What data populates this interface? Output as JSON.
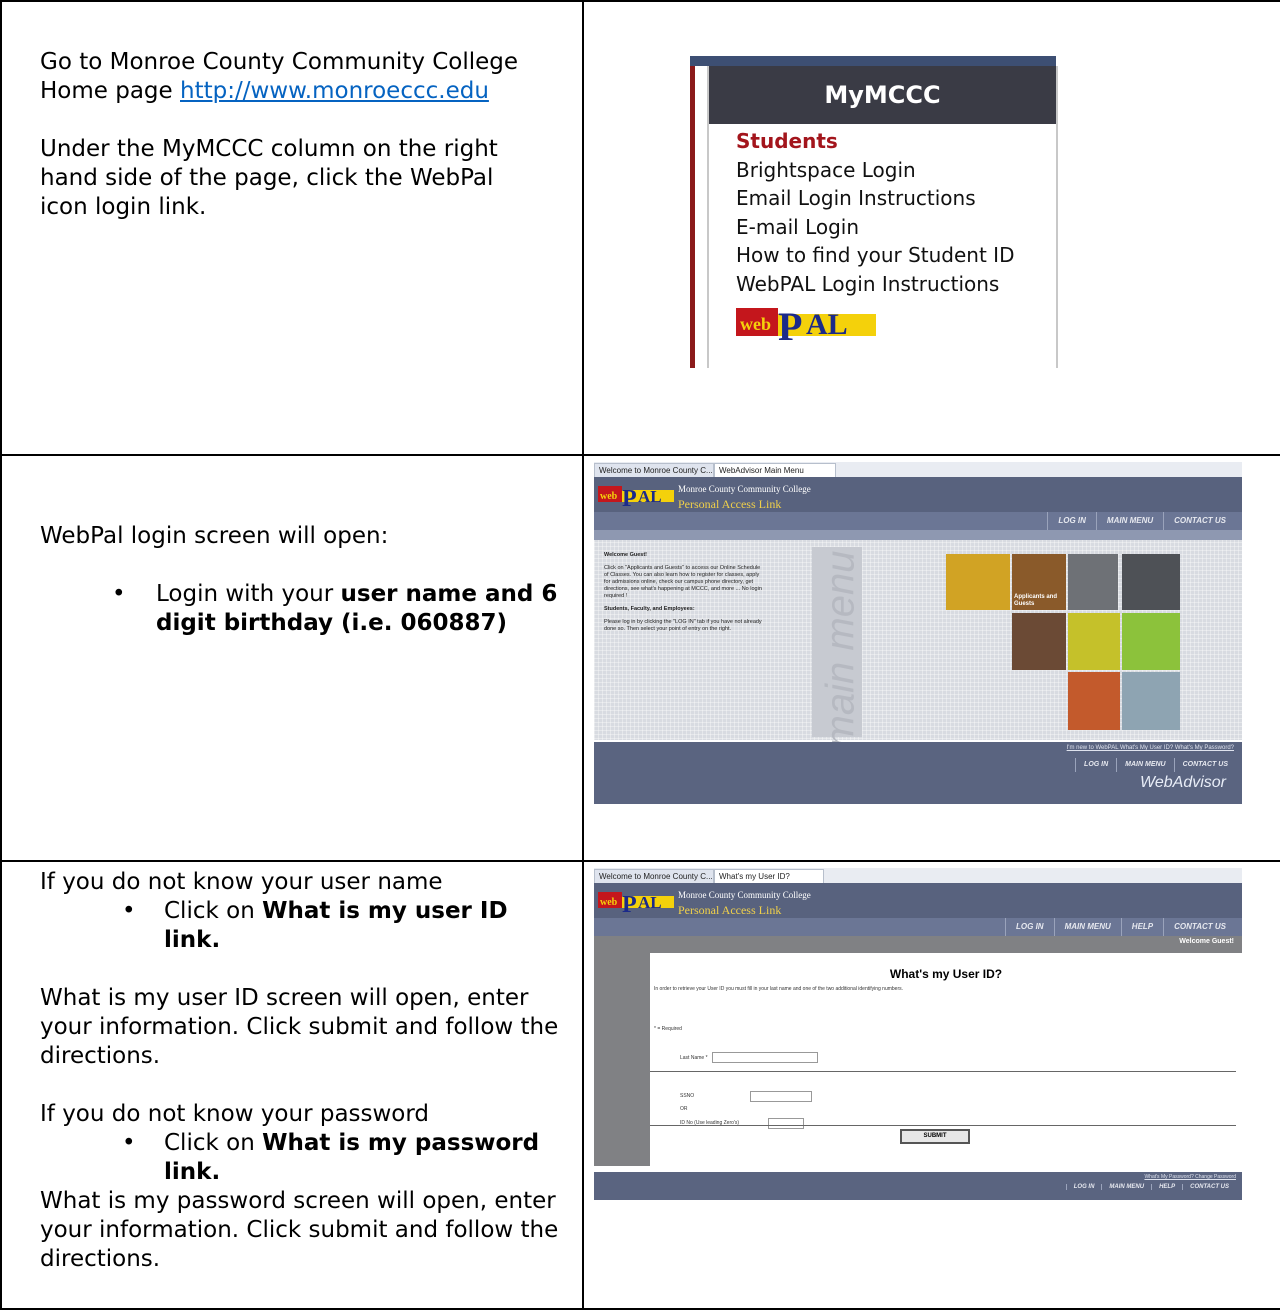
{
  "rows": [
    {
      "left": {
        "line1": "Go to Monroe County Community College",
        "line2_prefix": "Home page ",
        "link": "http://www.monroeccc.edu",
        "para2": "Under the MyMCCC column on the right hand side of the page, click the WebPal icon login link."
      }
    },
    {
      "left": {
        "intro": "WebPal login screen will open:",
        "bullet_prefix": "Login with your ",
        "bullet_bold": "user name and 6 digit birthday (i.e. 060887)"
      }
    },
    {
      "left": {
        "line1": "If you do not know your user name",
        "bullet1_prefix": "Click on ",
        "bullet1_bold": "What is my user ID link.",
        "para2": "What is my user ID screen will open, enter your information. Click submit and follow the directions.",
        "line3": "If you do not know your password",
        "bullet2_prefix": "Click on ",
        "bullet2_bold": "What is my password link.",
        "para4": "What is my password screen will open, enter your information. Click submit and follow the directions."
      }
    }
  ],
  "mymccc": {
    "header": "MyMCCC",
    "items": [
      "Students",
      "Brightspace Login",
      "Email Login Instructions",
      "E-mail Login",
      "How to find your Student ID",
      "WebPAL Login Instructions"
    ],
    "logo_text": "webPAL"
  },
  "webpal_login": {
    "tab1": "Welcome to Monroe County C...",
    "tab2": "WebAdvisor Main Menu",
    "college": "Monroe County Community College",
    "subtitle": "Personal Access Link",
    "nav": [
      "LOG IN",
      "MAIN MENU",
      "CONTACT US"
    ],
    "welcome_heading": "Welcome Guest!",
    "welcome_para1": "Click on \"Applicants and Guests\" to access our Online Schedule of Classes. You can also learn how to register for classes, apply for admissions online, check our campus phone directory, get directions, see what's happening at MCCC, and more ... No login required !",
    "welcome_heading2": "Students, Faculty, and Employees:",
    "welcome_para2": "Please log in by clicking the \"LOG IN\" tab if you have not already done so. Then select your point of entry on the right.",
    "side_text": "main menu",
    "tile_label": "Applicants and Guests",
    "footer_links": "I'm new to WebPAL   What's My User ID?   What's My Password?",
    "footer_nav": [
      "LOG IN",
      "MAIN MENU",
      "CONTACT US"
    ],
    "brand": "WebAdvisor"
  },
  "webpal_userid": {
    "tab1": "Welcome to Monroe County C...",
    "tab2": "What's my User ID?",
    "college": "Monroe County Community College",
    "subtitle": "Personal Access Link",
    "nav": [
      "LOG IN",
      "MAIN MENU",
      "HELP",
      "CONTACT US"
    ],
    "welcome": "Welcome Guest!",
    "title": "What's my User ID?",
    "instructions": "In order to retrieve your User ID you must fill in your last name and one of the two additional identifying numbers.",
    "required": "* = Required",
    "last_name_label": "Last Name *",
    "ssn_label": "SSNO",
    "or_label": "OR",
    "id_label": "ID No (Use leading Zero's)",
    "submit": "SUBMIT",
    "footer_links": "What's My Password?   Change Password",
    "footer_nav": [
      "LOG IN",
      "MAIN MENU",
      "HELP",
      "CONTACT US"
    ]
  }
}
